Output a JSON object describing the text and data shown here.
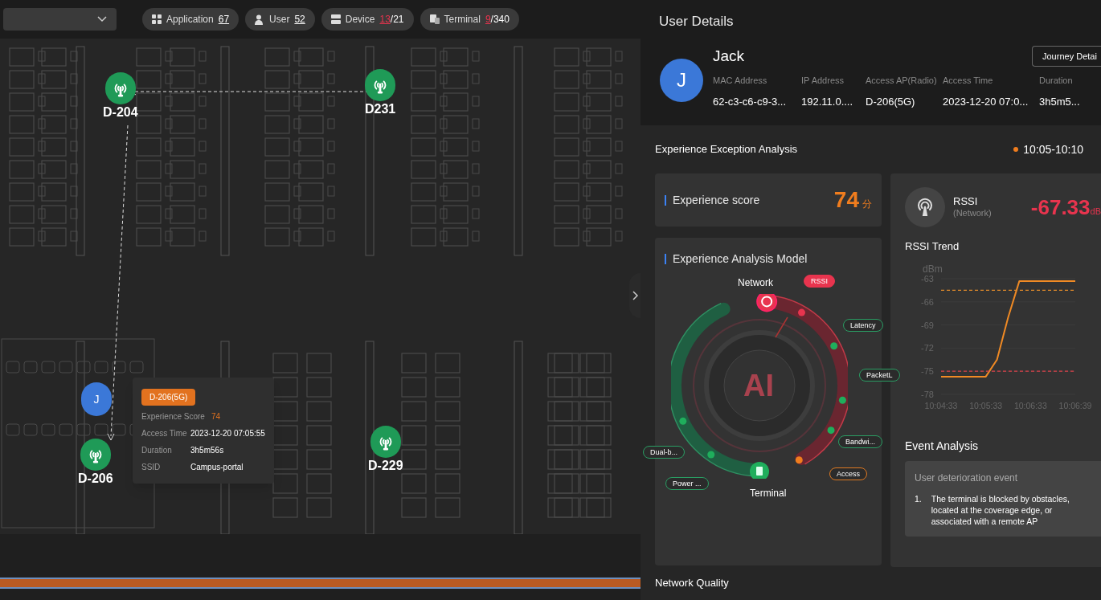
{
  "toolbar": {
    "chips": [
      {
        "kind": "application",
        "label": "Application",
        "count": "67",
        "alert": false
      },
      {
        "kind": "user",
        "label": "User",
        "count": "52",
        "alert": false
      },
      {
        "kind": "device",
        "label": "Device",
        "count": "13",
        "total": "/21",
        "alert": true
      },
      {
        "kind": "terminal",
        "label": "Terminal",
        "count": "9",
        "total": "/340",
        "alert": true
      }
    ]
  },
  "map": {
    "aps": [
      {
        "name": "D-204"
      },
      {
        "name": "D231"
      },
      {
        "name": "D-206"
      },
      {
        "name": "D-229"
      }
    ],
    "user": {
      "initial": "J"
    },
    "popup": {
      "badge": "D-206(5G)",
      "rows": [
        {
          "label": "Experience Score",
          "value": "74",
          "kind": "score"
        },
        {
          "label": "Access Time",
          "value": "2023-12-20 07:05:55",
          "kind": "plain"
        },
        {
          "label": "Duration",
          "value": "3h5m56s",
          "kind": "plain"
        },
        {
          "label": "SSID",
          "value": "Campus-portal",
          "kind": "plain"
        }
      ]
    }
  },
  "user_details": {
    "title": "User Details",
    "initial": "J",
    "name": "Jack",
    "button": "Journey Detai",
    "fields": [
      {
        "label": "MAC Address",
        "value": "62-c3-c6-c9-3..."
      },
      {
        "label": "IP Address",
        "value": "192.11.0...."
      },
      {
        "label": "Access AP(Radio)",
        "value": "D-206(5G)"
      },
      {
        "label": "Access Time",
        "value": "2023-12-20 07:0..."
      },
      {
        "label": "Duration",
        "value": "3h5m5..."
      }
    ]
  },
  "analysis": {
    "title": "Experience Exception Analysis",
    "time_range": "10:05-10:10",
    "score": {
      "label": "Experience score",
      "value": "74",
      "unit": "分"
    },
    "model": {
      "title": "Experience Analysis Model",
      "center": "AI",
      "top": "Network",
      "bottom": "Terminal",
      "tags": [
        {
          "text": "RSSI",
          "color": "#e8344e",
          "filled": true
        },
        {
          "text": "Latency",
          "color": "#2a9d63",
          "filled": false
        },
        {
          "text": "PacketL",
          "color": "#2a9d63",
          "filled": false
        },
        {
          "text": "Bandwi...",
          "color": "#2a9d63",
          "filled": false
        },
        {
          "text": "Access",
          "color": "#e07a22",
          "filled": false
        },
        {
          "text": "Dual-b...",
          "color": "#2a9d63",
          "filled": false
        },
        {
          "text": "Power ...",
          "color": "#2a9d63",
          "filled": false
        }
      ]
    },
    "rssi": {
      "label": "RSSI",
      "sublabel": "(Network)",
      "value": "-67.33",
      "unit": "dB",
      "trend_title": "RSSI Trend",
      "chart_data": {
        "type": "line",
        "ylabel": "dBm",
        "categories": [
          "10:04:33",
          null,
          null,
          null,
          "10:05:33",
          null,
          null,
          null,
          "10:06:33",
          null,
          null,
          null,
          "10:06:39"
        ],
        "series": [
          {
            "color": "#f08a24",
            "line_style": "solid",
            "values": [
              -75.7,
              -75.7,
              -75.7,
              -75.7,
              -75.7,
              -73.5,
              -68,
              -63.3,
              -63.3,
              -63.3,
              -63.3,
              -63.3,
              -63.3
            ]
          },
          {
            "color": "#e08a2a",
            "line_style": "dashed",
            "values": [
              -64.5,
              -64.5,
              -64.5,
              -64.5,
              -64.5,
              -64.5,
              -64.5,
              -64.5,
              -64.5,
              -64.5,
              -64.5,
              -64.5,
              -64.5
            ]
          },
          {
            "color": "#d9414a",
            "line_style": "dashed",
            "values": [
              -75,
              -75,
              -75,
              -75,
              -75,
              -75,
              -75,
              -75,
              -75,
              -75,
              -75,
              -75,
              -75
            ]
          }
        ],
        "yticks": [
          -63,
          -66,
          -69,
          -72,
          -75,
          -78
        ],
        "ylim": [
          -78,
          -63
        ],
        "grid": true
      }
    },
    "event": {
      "title": "Event Analysis",
      "heading": "User deterioration event",
      "items": [
        {
          "number": "1.",
          "text": "The terminal is blocked by obstacles, located at the coverage edge, or associated with a remote AP"
        }
      ]
    },
    "network_quality": {
      "title": "Network Quality"
    }
  }
}
